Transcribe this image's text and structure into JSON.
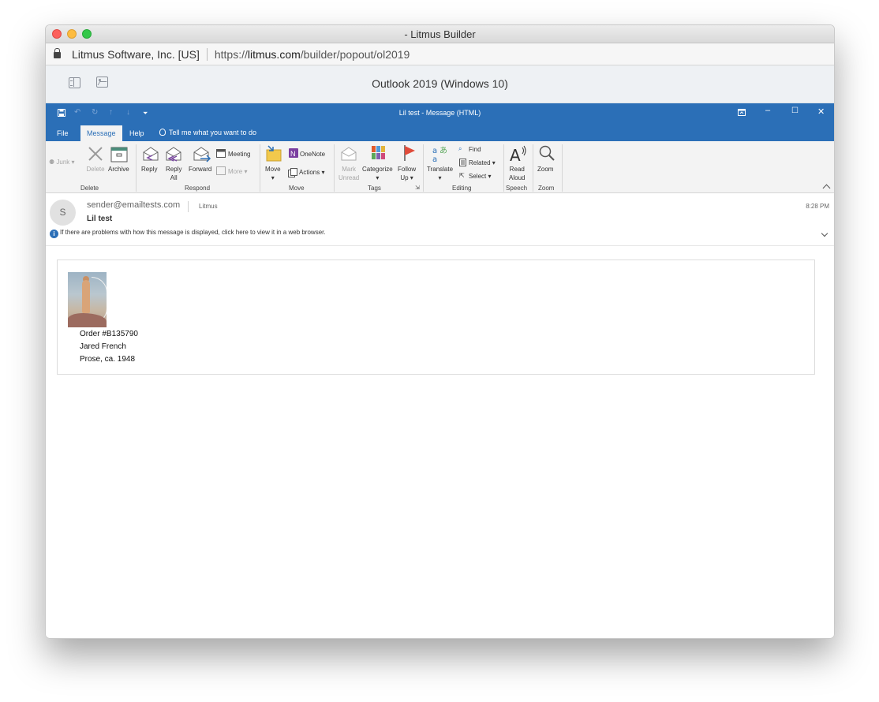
{
  "window": {
    "title": "- Litmus Builder"
  },
  "urlbar": {
    "org": "Litmus Software, Inc. [US]",
    "url_prefix": "https://",
    "url_domain": "litmus.com",
    "url_path": "/builder/popout/ol2019"
  },
  "litmus": {
    "client_title": "Outlook 2019 (Windows 10)"
  },
  "outlook": {
    "title": "Lil test  -  Message (HTML)",
    "tabs": [
      "File",
      "Message",
      "Help"
    ],
    "tell_me": "Tell me what you want to do",
    "ribbon": {
      "junk": "Junk",
      "delete": "Delete",
      "archive": "Archive",
      "reply": "Reply",
      "reply_all_1": "Reply",
      "reply_all_2": "All",
      "forward": "Forward",
      "meeting": "Meeting",
      "more": "More",
      "move": "Move",
      "onenote": "OneNote",
      "actions": "Actions",
      "mark_unread_1": "Mark",
      "mark_unread_2": "Unread",
      "categorize": "Categorize",
      "follow_up_1": "Follow",
      "follow_up_2": "Up",
      "translate": "Translate",
      "find": "Find",
      "related": "Related",
      "select": "Select",
      "read_aloud_1": "Read",
      "read_aloud_2": "Aloud",
      "zoom": "Zoom",
      "groups": {
        "delete": "Delete",
        "respond": "Respond",
        "move": "Move",
        "tags": "Tags",
        "editing": "Editing",
        "speech": "Speech",
        "zoom": "Zoom"
      }
    }
  },
  "message": {
    "avatar_initial": "S",
    "sender": "sender@emailtests.com",
    "to": "Litmus",
    "subject": "Lil test",
    "time": "8:28 PM",
    "info": "If there are problems with how this message is displayed, click here to view it in a web browser."
  },
  "email_body": {
    "order": "Order #B135790",
    "artist": "Jared French",
    "artwork": "Prose, ca. 1948"
  }
}
